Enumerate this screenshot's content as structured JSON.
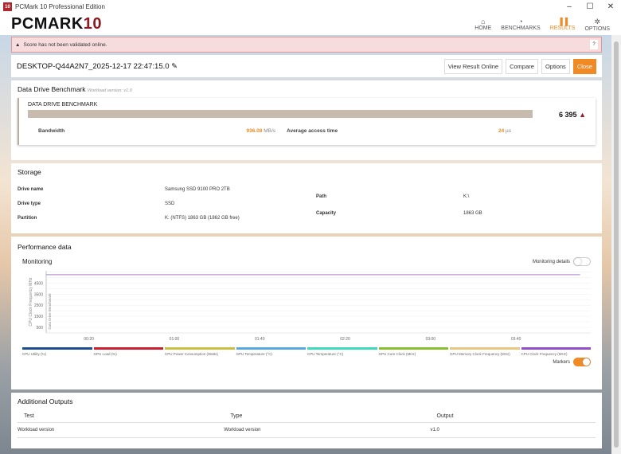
{
  "window": {
    "title": "PCMark 10 Professional Edition",
    "icon": "10",
    "min": "–",
    "max": "☐",
    "close": "✕"
  },
  "header": {
    "logo_main": "PCMARK",
    "logo_num": "10",
    "nav": [
      {
        "label": "HOME",
        "icon": "⌂"
      },
      {
        "label": "BENCHMARKS",
        "icon": "◔"
      },
      {
        "label": "RESULTS",
        "icon": "▐▐"
      },
      {
        "label": "OPTIONS",
        "icon": "✲"
      }
    ]
  },
  "alert": {
    "icon": "▲",
    "text": "Score has not been validated online.",
    "help": "?"
  },
  "result": {
    "title": "DESKTOP-Q44A2N7_2025-12-17 22:47:15.0",
    "edit_icon": "✎",
    "buttons": {
      "view": "View Result Online",
      "compare": "Compare",
      "options": "Options",
      "close": "Close"
    }
  },
  "benchmark": {
    "title": "Data Drive Benchmark",
    "version": "Workload version: v1.0",
    "card_title": "DATA DRIVE BENCHMARK",
    "score": "6 395",
    "warn_icon": "▲",
    "bandwidth_label": "Bandwidth",
    "bandwidth_value": "936.08",
    "bandwidth_unit": "MB/s",
    "access_label": "Average access time",
    "access_value": "24",
    "access_unit": "µs"
  },
  "storage": {
    "title": "Storage",
    "drive_name_label": "Drive name",
    "drive_name": "Samsung SSD 9100 PRO 2TB",
    "drive_type_label": "Drive type",
    "drive_type": "SSD",
    "partition_label": "Partition",
    "partition": "K: (NTFS) 1863 GB (1862 GB free)",
    "path_label": "Path",
    "path": "K:\\",
    "capacity_label": "Capacity",
    "capacity": "1863 GB"
  },
  "performance": {
    "title": "Performance data",
    "monitoring": "Monitoring",
    "monitoring_details": "Monitoring details",
    "markers": "Markers"
  },
  "chart_data": {
    "type": "line",
    "ylabel": "CPU Clock Frequency MHz",
    "marker_label": "Data Drive Benchmark",
    "yticks": [
      4500,
      3500,
      2500,
      1500,
      500
    ],
    "ylim": [
      0,
      5600
    ],
    "xticks": [
      "00:20",
      "01:00",
      "01:40",
      "02:20",
      "03:00",
      "03:40"
    ],
    "xlim": [
      0,
      255
    ],
    "series": [
      {
        "name": "CPU Clock Frequency (MHz)",
        "color": "#b89ad0",
        "x": [
          0,
          250
        ],
        "y": [
          5250,
          5250
        ]
      }
    ],
    "legend": [
      {
        "name": "CPU Utility (%)",
        "color": "#1f4e8c"
      },
      {
        "name": "GPU Load (%)",
        "color": "#c8202e"
      },
      {
        "name": "CPU Power Consumption (Watts)",
        "color": "#c8c040"
      },
      {
        "name": "GPU Temperature (°C)",
        "color": "#5aa8e0"
      },
      {
        "name": "CPU Temperature (°C)",
        "color": "#40d8b8"
      },
      {
        "name": "GPU Core Clock (MHz)",
        "color": "#88c030"
      },
      {
        "name": "GPU Memory Clock Frequency (MHz)",
        "color": "#e8c880"
      },
      {
        "name": "CPU Clock Frequency (MHz)",
        "color": "#9050c8"
      }
    ]
  },
  "outputs": {
    "title": "Additional Outputs",
    "headers": [
      "Test",
      "Type",
      "Output"
    ],
    "rows": [
      [
        "Workload version",
        "Workload version",
        "v1.0"
      ]
    ]
  }
}
